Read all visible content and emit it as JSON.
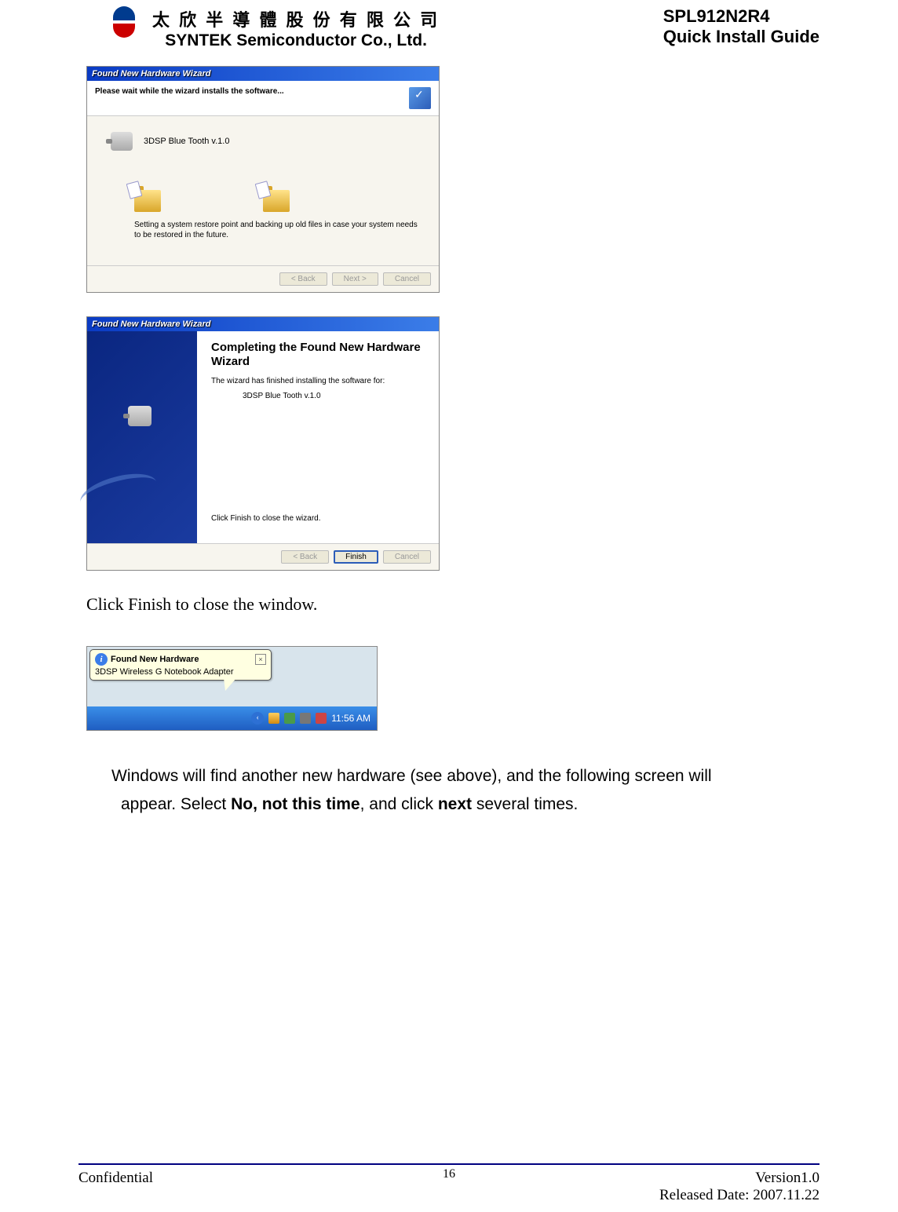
{
  "header": {
    "company_cn": "太 欣 半 導 體 股 份 有 限 公 司",
    "company_en": "SYNTEK Semiconductor Co., Ltd.",
    "product": "SPL912N2R4",
    "guide_title": "Quick Install Guide"
  },
  "wizard1": {
    "title": "Found New Hardware Wizard",
    "subtext": "Please wait while the wizard installs the software...",
    "device": "3DSP Blue Tooth v.1.0",
    "restore_text": "Setting a system restore point and backing up old files in case your system needs to be restored in the future.",
    "back": "< Back",
    "next": "Next >",
    "cancel": "Cancel"
  },
  "wizard2": {
    "title": "Found New Hardware Wizard",
    "heading": "Completing the Found New Hardware Wizard",
    "complete_text": "The wizard has finished installing the software for:",
    "device": "3DSP Blue Tooth v.1.0",
    "click_text": "Click Finish to close the wizard.",
    "back": "< Back",
    "finish": "Finish",
    "cancel": "Cancel"
  },
  "caption1": "Click Finish to close the window.",
  "balloon": {
    "title": "Found New Hardware",
    "msg": "3DSP Wireless G Notebook Adapter",
    "close": "×",
    "info": "i",
    "arrow": "‹",
    "time": "11:56 AM"
  },
  "para": {
    "line1_pre": "Windows will find another new hardware (see above), and the following screen will",
    "line2_pre": "appear. Select ",
    "bold1": "No, not this time",
    "mid": ", and click ",
    "bold2": "next",
    "tail": " several times."
  },
  "footer": {
    "left": "Confidential",
    "page": "16",
    "version": "Version1.0",
    "release": "Released Date: 2007.11.22"
  }
}
